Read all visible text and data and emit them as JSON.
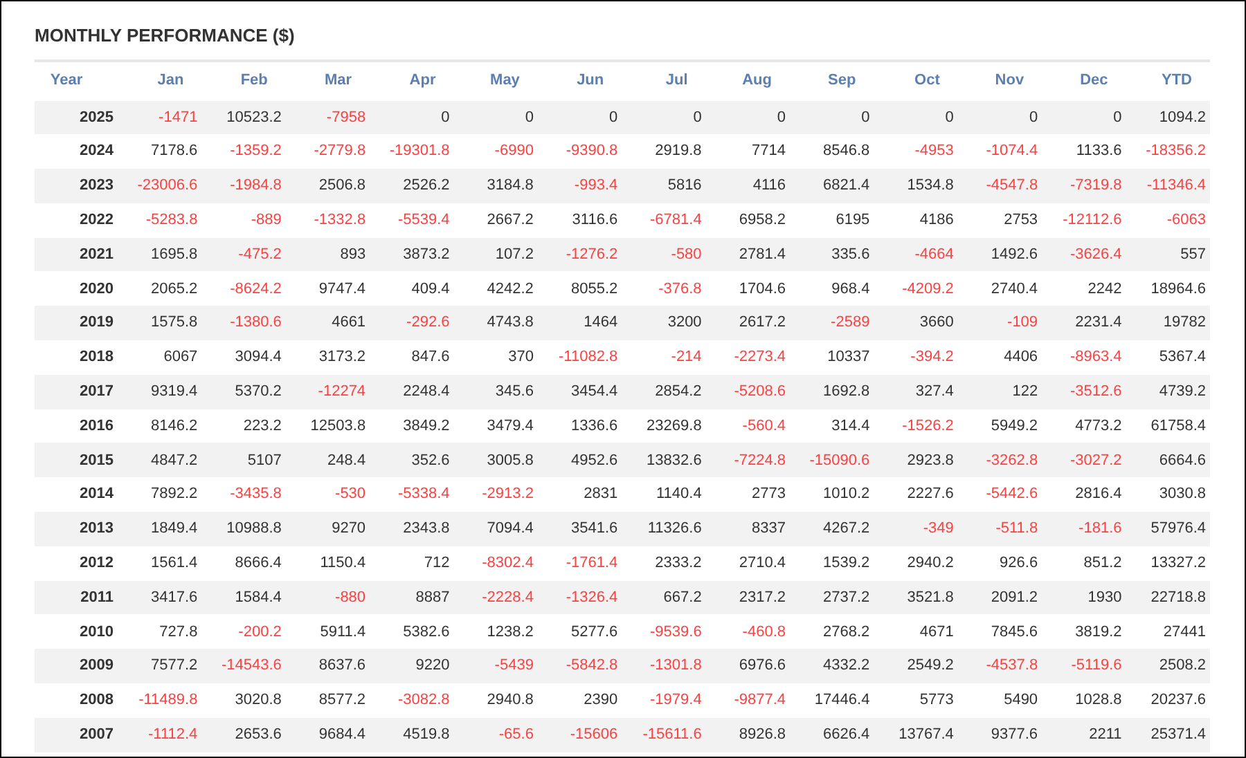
{
  "title": "MONTHLY PERFORMANCE ($)",
  "columns": [
    "Year",
    "Jan",
    "Feb",
    "Mar",
    "Apr",
    "May",
    "Jun",
    "Jul",
    "Aug",
    "Sep",
    "Oct",
    "Nov",
    "Dec",
    "YTD"
  ],
  "rows": [
    {
      "year": "2025",
      "values": [
        "-1471",
        "10523.2",
        "-7958",
        "0",
        "0",
        "0",
        "0",
        "0",
        "0",
        "0",
        "0",
        "0",
        "1094.2"
      ]
    },
    {
      "year": "2024",
      "values": [
        "7178.6",
        "-1359.2",
        "-2779.8",
        "-19301.8",
        "-6990",
        "-9390.8",
        "2919.8",
        "7714",
        "8546.8",
        "-4953",
        "-1074.4",
        "1133.6",
        "-18356.2"
      ]
    },
    {
      "year": "2023",
      "values": [
        "-23006.6",
        "-1984.8",
        "2506.8",
        "2526.2",
        "3184.8",
        "-993.4",
        "5816",
        "4116",
        "6821.4",
        "1534.8",
        "-4547.8",
        "-7319.8",
        "-11346.4"
      ]
    },
    {
      "year": "2022",
      "values": [
        "-5283.8",
        "-889",
        "-1332.8",
        "-5539.4",
        "2667.2",
        "3116.6",
        "-6781.4",
        "6958.2",
        "6195",
        "4186",
        "2753",
        "-12112.6",
        "-6063"
      ]
    },
    {
      "year": "2021",
      "values": [
        "1695.8",
        "-475.2",
        "893",
        "3873.2",
        "107.2",
        "-1276.2",
        "-580",
        "2781.4",
        "335.6",
        "-4664",
        "1492.6",
        "-3626.4",
        "557"
      ]
    },
    {
      "year": "2020",
      "values": [
        "2065.2",
        "-8624.2",
        "9747.4",
        "409.4",
        "4242.2",
        "8055.2",
        "-376.8",
        "1704.6",
        "968.4",
        "-4209.2",
        "2740.4",
        "2242",
        "18964.6"
      ]
    },
    {
      "year": "2019",
      "values": [
        "1575.8",
        "-1380.6",
        "4661",
        "-292.6",
        "4743.8",
        "1464",
        "3200",
        "2617.2",
        "-2589",
        "3660",
        "-109",
        "2231.4",
        "19782"
      ]
    },
    {
      "year": "2018",
      "values": [
        "6067",
        "3094.4",
        "3173.2",
        "847.6",
        "370",
        "-11082.8",
        "-214",
        "-2273.4",
        "10337",
        "-394.2",
        "4406",
        "-8963.4",
        "5367.4"
      ]
    },
    {
      "year": "2017",
      "values": [
        "9319.4",
        "5370.2",
        "-12274",
        "2248.4",
        "345.6",
        "3454.4",
        "2854.2",
        "-5208.6",
        "1692.8",
        "327.4",
        "122",
        "-3512.6",
        "4739.2"
      ]
    },
    {
      "year": "2016",
      "values": [
        "8146.2",
        "223.2",
        "12503.8",
        "3849.2",
        "3479.4",
        "1336.6",
        "23269.8",
        "-560.4",
        "314.4",
        "-1526.2",
        "5949.2",
        "4773.2",
        "61758.4"
      ]
    },
    {
      "year": "2015",
      "values": [
        "4847.2",
        "5107",
        "248.4",
        "352.6",
        "3005.8",
        "4952.6",
        "13832.6",
        "-7224.8",
        "-15090.6",
        "2923.8",
        "-3262.8",
        "-3027.2",
        "6664.6"
      ]
    },
    {
      "year": "2014",
      "values": [
        "7892.2",
        "-3435.8",
        "-530",
        "-5338.4",
        "-2913.2",
        "2831",
        "1140.4",
        "2773",
        "1010.2",
        "2227.6",
        "-5442.6",
        "2816.4",
        "3030.8"
      ]
    },
    {
      "year": "2013",
      "values": [
        "1849.4",
        "10988.8",
        "9270",
        "2343.8",
        "7094.4",
        "3541.6",
        "11326.6",
        "8337",
        "4267.2",
        "-349",
        "-511.8",
        "-181.6",
        "57976.4"
      ]
    },
    {
      "year": "2012",
      "values": [
        "1561.4",
        "8666.4",
        "1150.4",
        "712",
        "-8302.4",
        "-1761.4",
        "2333.2",
        "2710.4",
        "1539.2",
        "2940.2",
        "926.6",
        "851.2",
        "13327.2"
      ]
    },
    {
      "year": "2011",
      "values": [
        "3417.6",
        "1584.4",
        "-880",
        "8887",
        "-2228.4",
        "-1326.4",
        "667.2",
        "2317.2",
        "2737.2",
        "3521.8",
        "2091.2",
        "1930",
        "22718.8"
      ]
    },
    {
      "year": "2010",
      "values": [
        "727.8",
        "-200.2",
        "5911.4",
        "5382.6",
        "1238.2",
        "5277.6",
        "-9539.6",
        "-460.8",
        "2768.2",
        "4671",
        "7845.6",
        "3819.2",
        "27441"
      ]
    },
    {
      "year": "2009",
      "values": [
        "7577.2",
        "-14543.6",
        "8637.6",
        "9220",
        "-5439",
        "-5842.8",
        "-1301.8",
        "6976.6",
        "4332.2",
        "2549.2",
        "-4537.8",
        "-5119.6",
        "2508.2"
      ]
    },
    {
      "year": "2008",
      "values": [
        "-11489.8",
        "3020.8",
        "8577.2",
        "-3082.8",
        "2940.8",
        "2390",
        "-1979.4",
        "-9877.4",
        "17446.4",
        "5773",
        "5490",
        "1028.8",
        "20237.6"
      ]
    },
    {
      "year": "2007",
      "values": [
        "-1112.4",
        "2653.6",
        "9684.4",
        "4519.8",
        "-65.6",
        "-15606",
        "-15611.6",
        "8926.8",
        "6626.4",
        "13767.4",
        "9377.6",
        "2211",
        "25371.4"
      ]
    }
  ]
}
